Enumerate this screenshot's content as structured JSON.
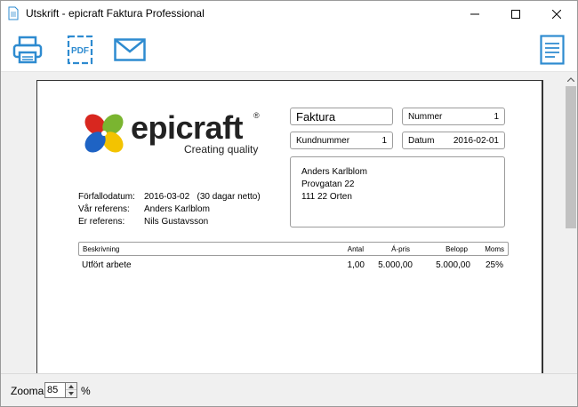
{
  "window": {
    "title": "Utskrift - epicraft Faktura Professional"
  },
  "toolbar": {
    "icons": [
      "printer-icon",
      "pdf-icon",
      "mail-icon",
      "document-list-icon"
    ],
    "pdf_text": "PDF",
    "accent": "#2e8bd0"
  },
  "logo": {
    "word": "epicraft",
    "reg": "®",
    "tagline": "Creating quality"
  },
  "invoice": {
    "title": "Faktura",
    "nummer_label": "Nummer",
    "nummer": "1",
    "kund_label": "Kundnummer",
    "kund": "1",
    "datum_label": "Datum",
    "datum": "2016-02-01",
    "address": [
      "Anders Karlblom",
      "Provgatan 22",
      "111 22 Orten"
    ],
    "refs": [
      {
        "k": "Förfallodatum:",
        "v": "2016-03-02   (30 dagar netto)"
      },
      {
        "k": "Vår referens:",
        "v": "Anders Karlblom"
      },
      {
        "k": "Er referens:",
        "v": "Nils Gustavsson"
      }
    ],
    "columns": {
      "desc": "Beskrivning",
      "qty": "Antal",
      "price": "Á-pris",
      "amount": "Belopp",
      "vat": "Moms"
    },
    "rows": [
      {
        "desc": "Utfört arbete",
        "qty": "1,00",
        "price": "5.000,00",
        "amount": "5.000,00",
        "vat": "25%"
      }
    ]
  },
  "status": {
    "zoom_label": "Zooma",
    "zoom_value": "85",
    "pct": "%"
  }
}
